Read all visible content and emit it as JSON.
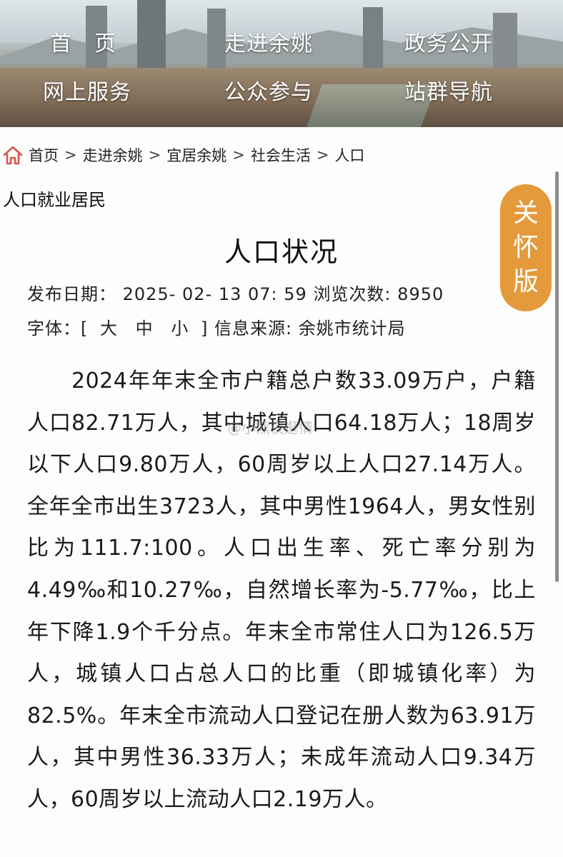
{
  "nav": {
    "home": "首　页",
    "about": "走进余姚",
    "gov_open": "政务公开",
    "online": "网上服务",
    "participate": "公众参与",
    "site_nav": "站群导航"
  },
  "breadcrumb": {
    "items": [
      "首页",
      "走进余姚",
      "宜居余姚",
      "社会生活",
      "人口"
    ],
    "separator": ">"
  },
  "section_title": "人口就业居民",
  "care_mode": {
    "chars": [
      "关",
      "怀",
      "版"
    ],
    "color": "#e49a3b"
  },
  "article": {
    "title": "人口状况",
    "publish_label": "发布日期：",
    "publish_date": "2025- 02- 13 07: 59",
    "views_label": "浏览次数:",
    "views": "8950",
    "font_label": "字体：[",
    "font_large": "大",
    "font_medium": "中",
    "font_small": "小",
    "font_close": "]",
    "source_label": "信息来源:",
    "source": "余姚市统计局",
    "body": "2024年年末全市户籍总户数33.09万户，户籍人口82.71万人，其中城镇人口64.18万人；18周岁以下人口9.80万人，60周岁以上人口27.14万人。全年全市出生3723人，其中男性1964人，男女性别比为111.7:100。人口出生率、死亡率分别为4.49‰和10.27‰，自然增长率为-5.77‰，比上年下降1.9个千分点。年末全市常住人口为126.5万人，城镇人口占总人口的比重（即城镇化率）为82.5%。年末全市流动人口登记在册人数为63.91万人，其中男性36.33万人；未成年流动人口9.34万人，60周岁以上流动人口2.19万人。"
  },
  "watermark": "@小熊夜逛情"
}
